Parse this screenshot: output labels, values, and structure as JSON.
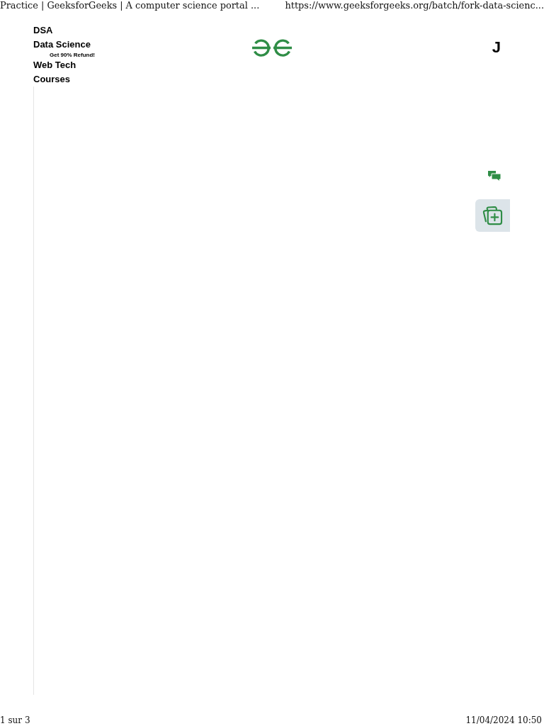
{
  "print_header": {
    "title": "Practice | GeeksforGeeks | A computer science portal ...",
    "url": "https://www.geeksforgeeks.org/batch/fork-data-scienc..."
  },
  "nav": {
    "items": [
      {
        "label": "DSA"
      },
      {
        "label": "Data Science"
      },
      {
        "label": "Web Tech",
        "badge": "Get 90% Refund!"
      },
      {
        "label": "Courses"
      }
    ]
  },
  "user": {
    "initial": "J"
  },
  "print_footer": {
    "page": "1 sur 3",
    "datetime": "11/04/2024 10:50"
  }
}
